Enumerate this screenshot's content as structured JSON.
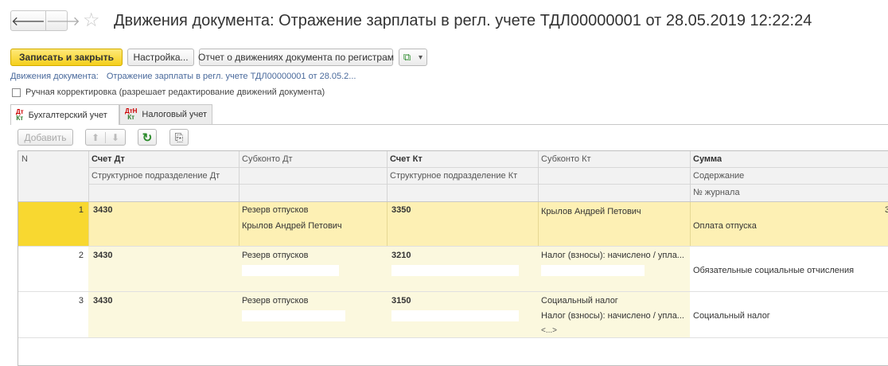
{
  "window": {
    "title": "Движения документа: Отражение зарплаты в регл. учете ТДЛ00000001 от 28.05.2019 12:22:24",
    "nav_back": "🡐",
    "nav_forward": "🡒",
    "star_icon": "☆"
  },
  "toolbar": {
    "save_close": "Записать и закрыть",
    "settings": "Настройка...",
    "report": "Отчет о движениях документа по регистрам",
    "extra_icon": "⧉",
    "extra_chevron": "▾"
  },
  "doc_link": {
    "label": "Движения документа:",
    "value": "Отражение зарплаты в регл. учете ТДЛ00000001 от 28.05.2..."
  },
  "manual": {
    "label": "Ручная корректировка (разрешает редактирование движений документа)"
  },
  "tabs": [
    {
      "label": "Бухгалтерский учет",
      "icon_top": "Дт",
      "icon_bottom": "Кт"
    },
    {
      "label": "Налоговый учет",
      "icon_top": "ДтН",
      "icon_bottom": "Кт"
    }
  ],
  "table_toolbar": {
    "add": "Добавить",
    "up_icon": "⬆",
    "down_icon": "⬇",
    "refresh_icon": "↻",
    "export_icon": "⎘"
  },
  "columns": {
    "n": "N",
    "schet_dt": "Счет Дт",
    "subkonto_dt": "Субконто Дт",
    "schet_kt": "Счет Кт",
    "subkonto_kt": "Субконто Кт",
    "summa": "Сумма",
    "podr_dt": "Структурное подразделение Дт",
    "podr_kt": "Структурное подразделение Кт",
    "soderzhanie": "Содержание",
    "zhurnal": "№ журнала"
  },
  "rows": [
    {
      "n": "1",
      "schet_dt": "3430",
      "subkonto_dt_1": "Резерв отпусков",
      "subkonto_dt_2": "Крылов Андрей Петович",
      "schet_kt": "3350",
      "subkonto_kt_1": "Крылов Андрей Петович",
      "subkonto_kt_2": "",
      "subkonto_kt_3": "",
      "summa": "3",
      "soderzhanie": "Оплата отпуска"
    },
    {
      "n": "2",
      "schet_dt": "3430",
      "subkonto_dt_1": "Резерв отпусков",
      "subkonto_dt_2": "",
      "schet_kt": "3210",
      "subkonto_kt_1": "Налог (взносы): начислено / упла...",
      "subkonto_kt_2": "",
      "subkonto_kt_3": "",
      "summa": "",
      "soderzhanie": "Обязательные социальные отчисления"
    },
    {
      "n": "3",
      "schet_dt": "3430",
      "subkonto_dt_1": "Резерв отпусков",
      "subkonto_dt_2": "",
      "schet_kt": "3150",
      "subkonto_kt_1": "Социальный налог",
      "subkonto_kt_2": "Налог (взносы): начислено / упла...",
      "subkonto_kt_3": "<...>",
      "summa": "",
      "soderzhanie": "Социальный налог"
    }
  ],
  "colors": {
    "primary_button": "#f5cf1c",
    "selected_row": "#fdf0b4",
    "selected_n_cell": "#f8d830",
    "row_tint": "#fbf8de",
    "link": "#4a6a9c"
  }
}
